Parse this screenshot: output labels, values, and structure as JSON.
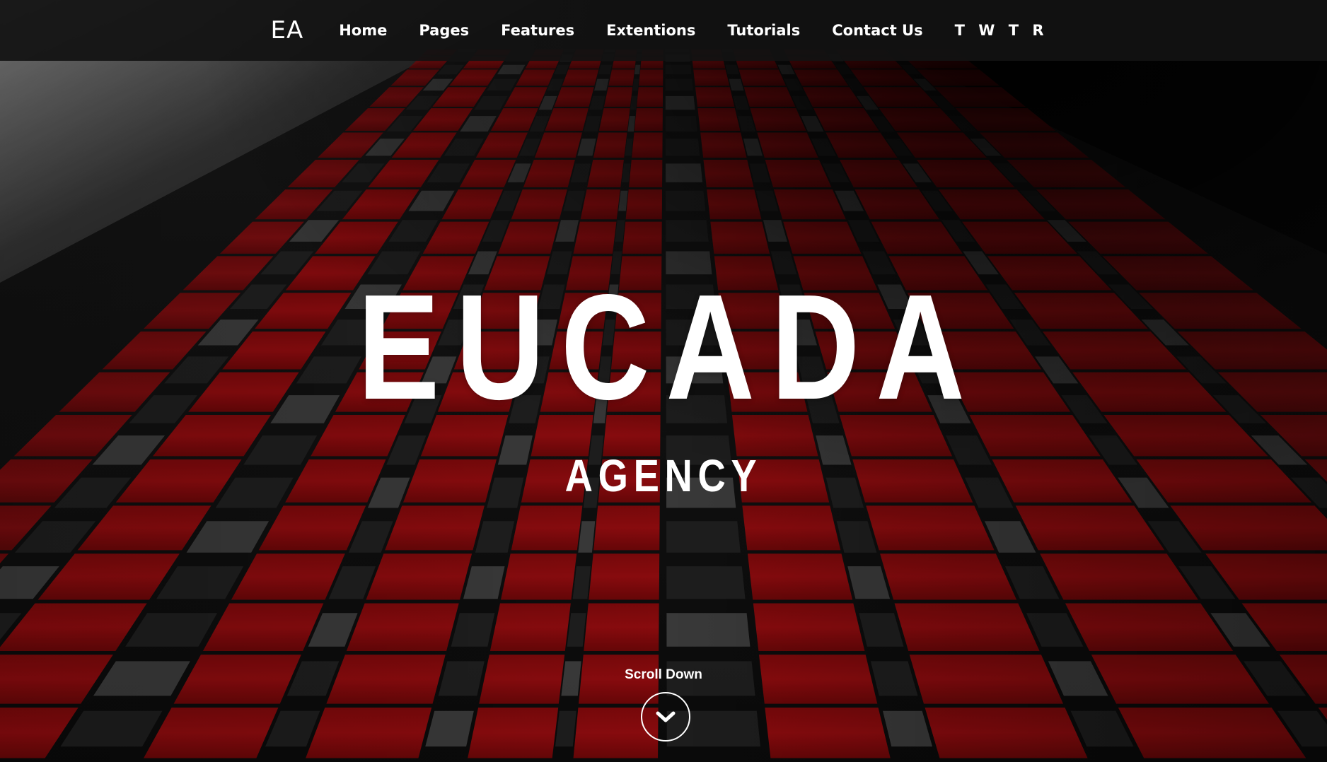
{
  "nav": {
    "logo": "EA",
    "items": [
      {
        "label": "Home"
      },
      {
        "label": "Pages"
      },
      {
        "label": "Features"
      },
      {
        "label": "Extentions"
      },
      {
        "label": "Tutorials"
      },
      {
        "label": "Contact Us"
      },
      {
        "label": "T W T R"
      }
    ]
  },
  "hero": {
    "title": "EUCADA",
    "subtitle": "AGENCY",
    "scroll_label": "Scroll Down",
    "scroll_icon": "chevron-down-icon",
    "background": "red-facade-building-photo"
  },
  "colors": {
    "nav_bg": "#121212",
    "accent_red": "#a80d0f",
    "text": "#ffffff"
  }
}
